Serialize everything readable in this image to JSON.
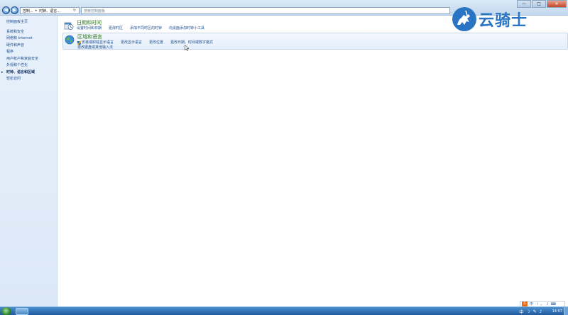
{
  "address_bar": {
    "crumbs": [
      "控制...",
      "时钟、语言..."
    ],
    "separator": "▸",
    "refresh_icon": "refresh-icon",
    "search_placeholder": "搜索控制面板"
  },
  "window_controls": {
    "minimize": "—",
    "maximize": "□",
    "close": "✕"
  },
  "sidebar": {
    "home": "控制面板主页",
    "items": [
      {
        "label": "系统和安全"
      },
      {
        "label": "网络和 Internet"
      },
      {
        "label": "硬件和声音"
      },
      {
        "label": "程序"
      },
      {
        "label": "用户帐户和家庭安全"
      },
      {
        "label": "外观和个性化"
      },
      {
        "label": "时钟、语言和区域",
        "active": true
      },
      {
        "label": "轻松访问"
      }
    ]
  },
  "categories": {
    "datetime": {
      "title": "日期和时间",
      "icon": "clock-calendar-icon",
      "links": [
        "设置时间和日期",
        "更改时区",
        "添加不同时区的时钟",
        "向桌面添加时钟小工具"
      ]
    },
    "region": {
      "title": "区域和语言",
      "icon": "globe-icon",
      "links_row1": [
        "安装或卸载显示语言",
        "更改显示语言",
        "更改位置",
        "更改日期、时间或数字格式"
      ],
      "links_row2": [
        "更改键盘或其他输入法"
      ]
    }
  },
  "logo": {
    "text": "云骑士",
    "icon": "knight-on-horse-logo-icon"
  },
  "taskbar": {
    "clock": "14:57",
    "tray_icons": [
      "中",
      "☽",
      "✎",
      "♪"
    ],
    "ime_bar": {
      "logo": "S",
      "items": [
        "中",
        "☽",
        "。",
        "♪",
        "⌨"
      ]
    }
  },
  "colors": {
    "link": "#1d4f8f",
    "category_title": "#2a7a15",
    "logo": "#2a74c4",
    "taskbar": "#1f5a9e"
  }
}
